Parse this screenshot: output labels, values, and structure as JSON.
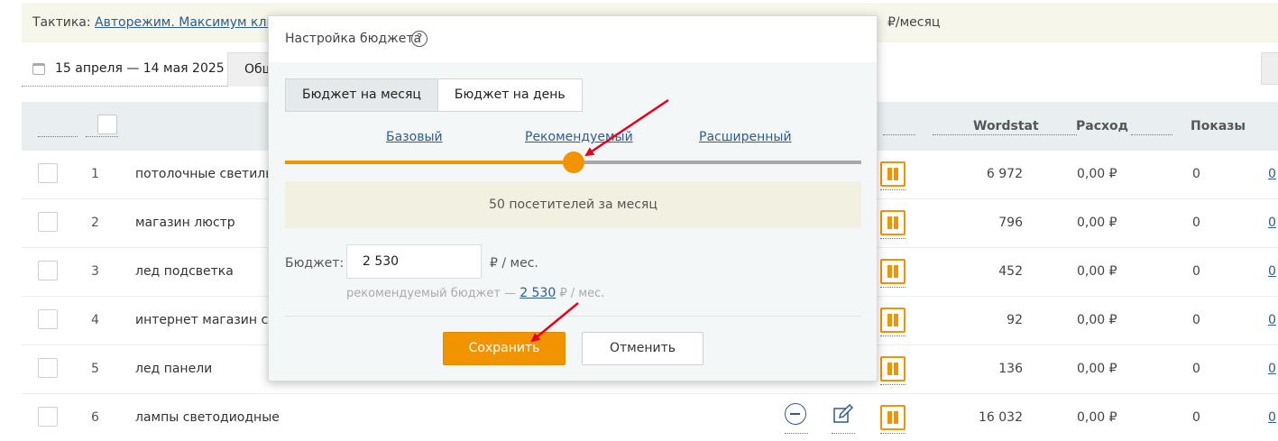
{
  "tactic": {
    "label": "Тактика:",
    "link": "Авторежим. Максимум кликов",
    "suffix": "₽/месяц"
  },
  "toolbar": {
    "date_range": "15 апреля — 14 мая 2025",
    "tab_partial": "Общ"
  },
  "table": {
    "columns": {
      "wordstat": "Wordstat",
      "cost": "Расход",
      "shows": "Показы"
    },
    "rows": [
      {
        "num": "1",
        "keyword": "потолочные светильн",
        "wordstat": "6 972",
        "cost": "0,00 ₽",
        "shows": "0",
        "link": "0"
      },
      {
        "num": "2",
        "keyword": "магазин люстр",
        "wordstat": "796",
        "cost": "0,00 ₽",
        "shows": "0",
        "link": "0"
      },
      {
        "num": "3",
        "keyword": "лед подсветка",
        "wordstat": "452",
        "cost": "0,00 ₽",
        "shows": "0",
        "link": "0"
      },
      {
        "num": "4",
        "keyword": "интернет магазин све",
        "wordstat": "92",
        "cost": "0,00 ₽",
        "shows": "0",
        "link": "0"
      },
      {
        "num": "5",
        "keyword": "лед панели",
        "wordstat": "136",
        "cost": "0,00 ₽",
        "shows": "0",
        "link": "0"
      },
      {
        "num": "6",
        "keyword": "лампы светодиодные",
        "wordstat": "16 032",
        "cost": "0,00 ₽",
        "shows": "0",
        "link": "0"
      }
    ]
  },
  "modal": {
    "title": "Настройка бюджета",
    "help_glyph": "?",
    "tabs": [
      "Бюджет на месяц",
      "Бюджет на день"
    ],
    "active_tab": "Бюджет на месяц",
    "levels": [
      "Базовый",
      "Рекомендуемый",
      "Расширенный"
    ],
    "slider_value": 0.5,
    "info_text": "50 посетителей за месяц",
    "budget_label": "Бюджет:",
    "budget_value": "2 530",
    "budget_unit": "₽ / мес.",
    "recommended_prefix": "рекомендуемый бюджет —",
    "recommended_value": "2 530",
    "recommended_unit": "₽ / мес.",
    "save_label": "Сохранить",
    "cancel_label": "Отменить"
  },
  "colors": {
    "accent": "#f29400",
    "link": "#2d5d8e",
    "annotation": "#e8001c"
  },
  "icons": [
    "calendar-icon",
    "help-icon",
    "minus-circle-icon",
    "edit-icon",
    "pause-icon"
  ]
}
